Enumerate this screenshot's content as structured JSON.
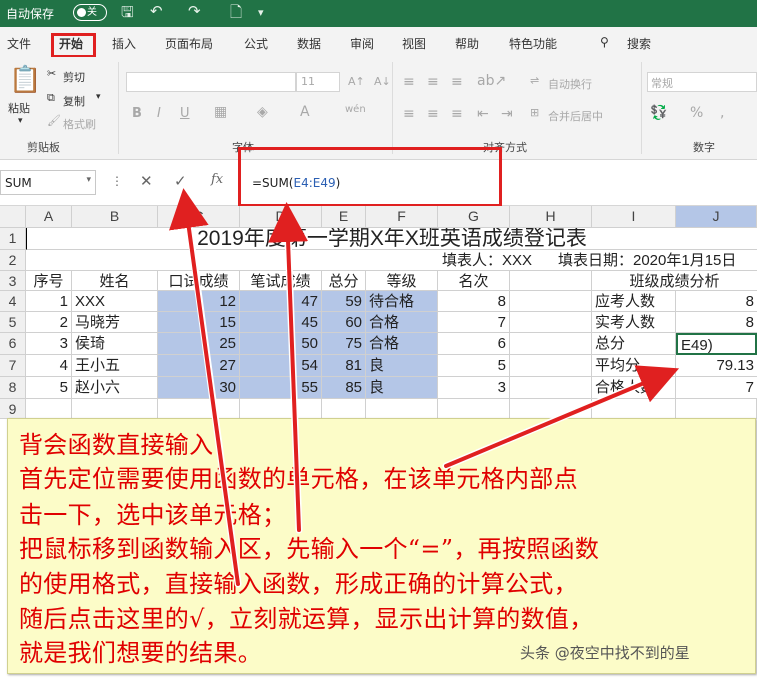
{
  "titlebar": {
    "autosave_label": "自动保存",
    "autosave_state": "关"
  },
  "tabs": [
    "文件",
    "开始",
    "插入",
    "页面布局",
    "公式",
    "数据",
    "审阅",
    "视图",
    "帮助",
    "特色功能",
    "搜索"
  ],
  "ribbon": {
    "paste": "粘贴",
    "cut": "剪切",
    "copy": "复制",
    "format_painter": "格式刷",
    "clipboard_group": "剪贴板",
    "font_size": "11",
    "font_group": "字体",
    "wrap": "自动换行",
    "merge": "合并后居中",
    "align_group": "对齐方式",
    "number_format": "常规",
    "number_group": "数字",
    "bold": "B",
    "italic": "I",
    "underline": "U"
  },
  "formula_bar": {
    "name_box": "SUM",
    "cancel": "✕",
    "enter": "✓",
    "fx": "fx",
    "formula_prefix": "=SUM(",
    "formula_ref": "E4:E49",
    "formula_suffix": ")"
  },
  "columns": [
    "A",
    "B",
    "C",
    "D",
    "E",
    "F",
    "G",
    "H",
    "I",
    "J"
  ],
  "rows": [
    "1",
    "2",
    "3",
    "4",
    "5",
    "6",
    "7",
    "8",
    "9"
  ],
  "sheet": {
    "title": "2019年度第一学期X年X班英语成绩登记表",
    "filler": "填表人：XXX",
    "fill_date": "填表日期：2020年1月15日",
    "headers": [
      "序号",
      "姓名",
      "口试成绩",
      "笔试成绩",
      "总分",
      "等级",
      "名次",
      "",
      "班级成绩分析"
    ],
    "data": [
      [
        "1",
        "XXX",
        "12",
        "47",
        "59",
        "待合格",
        "8"
      ],
      [
        "2",
        "马晓芳",
        "15",
        "45",
        "60",
        "合格",
        "7"
      ],
      [
        "3",
        "侯琦",
        "25",
        "50",
        "75",
        "合格",
        "6"
      ],
      [
        "4",
        "王小五",
        "27",
        "54",
        "81",
        "良",
        "5"
      ],
      [
        "5",
        "赵小六",
        "30",
        "55",
        "85",
        "良",
        "3"
      ]
    ],
    "analysis": [
      [
        "应考人数",
        "8"
      ],
      [
        "实考人数",
        "8"
      ],
      [
        "总分",
        "E49)"
      ],
      [
        "平均分",
        "79.13"
      ],
      [
        "合格人数",
        "7"
      ]
    ]
  },
  "note": {
    "lines": [
      "背会函数直接输入：",
      "首先定位需要使用函数的单元格，在该单元格内部点",
      "击一下，选中该单元格；",
      "把鼠标移到函数输入区，先输入一个“=”，再按照函数",
      "的使用格式，直接输入函数，形成正确的计算公式，",
      "随后点击这里的√，立刻就运算，显示出计算的数值，",
      "就是我们想要的结果。"
    ]
  },
  "watermark": "头条 @夜空中找不到的星",
  "colors": {
    "excel_green": "#217346",
    "annotation_red": "#e02020",
    "selection": "#b4c6e7",
    "note_bg": "#fcfcc8"
  }
}
